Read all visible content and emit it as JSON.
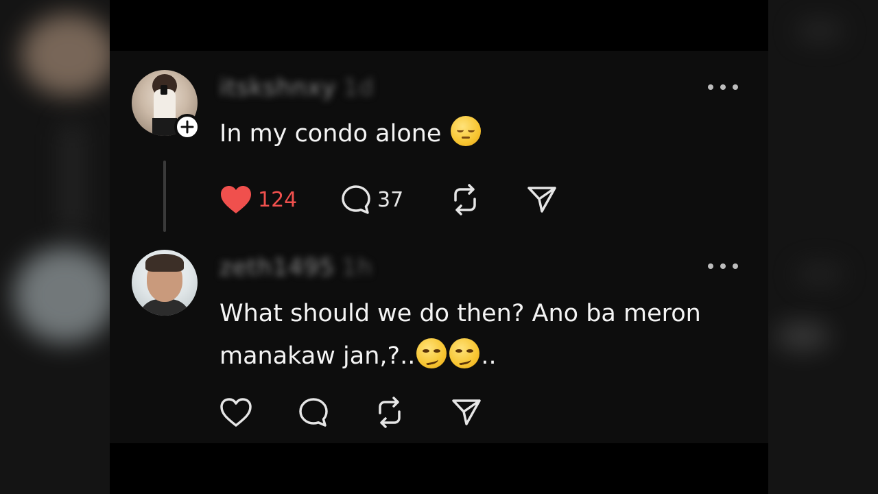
{
  "posts": [
    {
      "username": "itskshnxy",
      "time": "1d",
      "text": "In my condo alone",
      "emoji": "pensive-face",
      "likes": "124",
      "liked": true,
      "replies": "37",
      "has_follow_badge": true
    },
    {
      "username": "zeth1495",
      "time": "1h",
      "text_line1": "What should we do then? Ano ba meron",
      "text_line2_prefix": "manakaw jan,?..",
      "text_line2_suffix": "..",
      "emoji": "smirking-face",
      "liked": false
    }
  ],
  "colors": {
    "like_red": "#f0504d",
    "background": "#0d0d0d",
    "text": "#f4f4f4"
  },
  "icons": [
    "heart-icon",
    "comment-icon",
    "repost-icon",
    "share-icon",
    "more-icon",
    "plus-icon"
  ]
}
